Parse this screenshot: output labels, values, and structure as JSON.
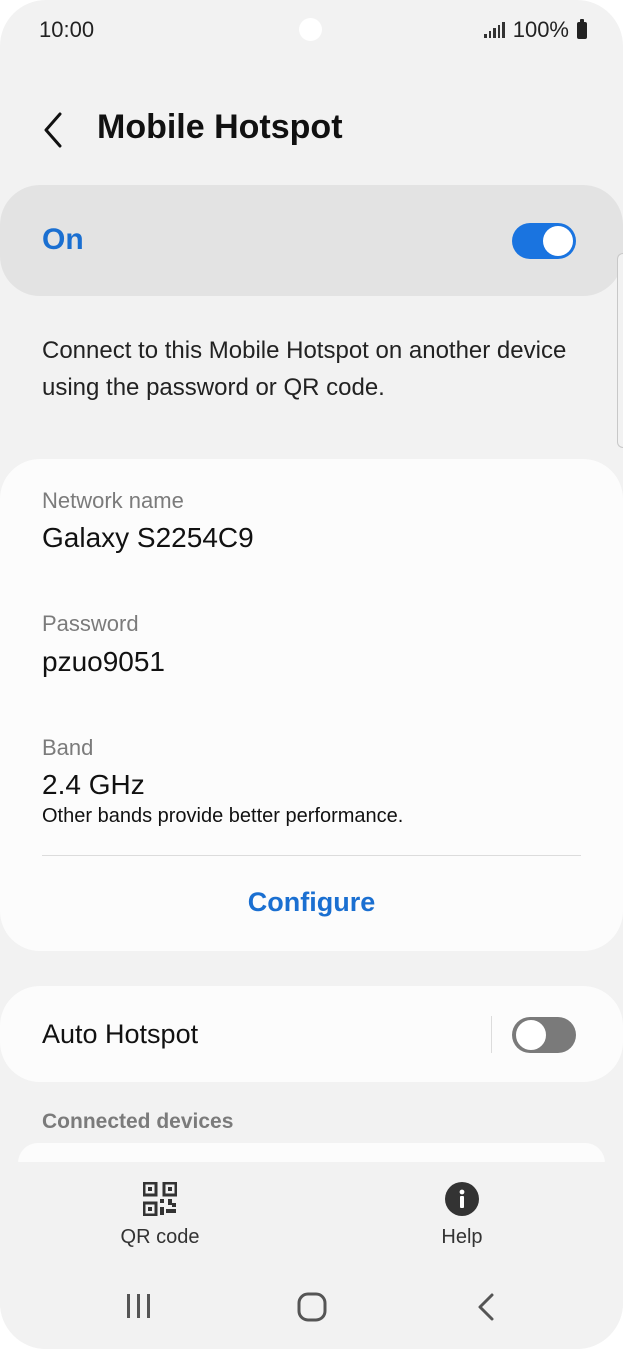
{
  "status_bar": {
    "time": "10:00",
    "battery": "100%"
  },
  "header": {
    "title": "Mobile Hotspot"
  },
  "master_switch": {
    "label": "On",
    "state": "on",
    "accent": "#1a74e0"
  },
  "description": "Connect to this Mobile Hotspot on another device using the password or QR code.",
  "network": {
    "name_label": "Network name",
    "name_value": "Galaxy S2254C9",
    "password_label": "Password",
    "password_value": "pzuo9051",
    "band_label": "Band",
    "band_value": "2.4 GHz",
    "band_note": "Other bands provide better performance.",
    "configure_label": "Configure"
  },
  "auto_hotspot": {
    "label": "Auto Hotspot",
    "state": "off"
  },
  "connected_devices": {
    "title": "Connected devices"
  },
  "bottom_actions": {
    "qr_label": "QR code",
    "help_label": "Help"
  },
  "colors": {
    "accent": "#1a6fd1",
    "background": "#f2f2f2",
    "card": "#fcfcfc"
  }
}
